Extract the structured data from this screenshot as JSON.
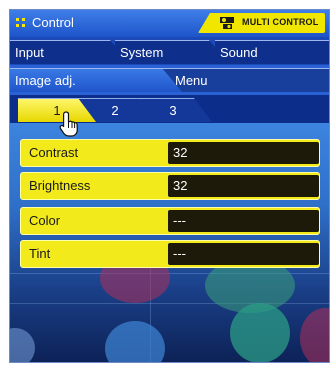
{
  "window": {
    "title": "Control",
    "brand_badge": "MULTI CONTROL",
    "title_icon": "grid-dots-icon",
    "badge_icon": "projector-icon"
  },
  "tabs_row1": [
    {
      "label": "Input"
    },
    {
      "label": "System"
    },
    {
      "label": "Sound"
    }
  ],
  "tabs_row2": [
    {
      "label": "Image adj.",
      "active": true
    },
    {
      "label": "Menu",
      "active": false
    }
  ],
  "subtabs": [
    {
      "label": "1",
      "active": true
    },
    {
      "label": "2",
      "active": false
    },
    {
      "label": "3",
      "active": false
    }
  ],
  "settings": [
    {
      "label": "Contrast",
      "value": "32"
    },
    {
      "label": "Brightness",
      "value": "32"
    },
    {
      "label": "Color",
      "value": "---"
    },
    {
      "label": "Tint",
      "value": "---"
    }
  ],
  "cursor": "hand-pointer-icon",
  "colors": {
    "accent_yellow": "#f2ea1a",
    "value_bg": "#1e1a0a",
    "panel_blue": "#0b2e8a"
  }
}
